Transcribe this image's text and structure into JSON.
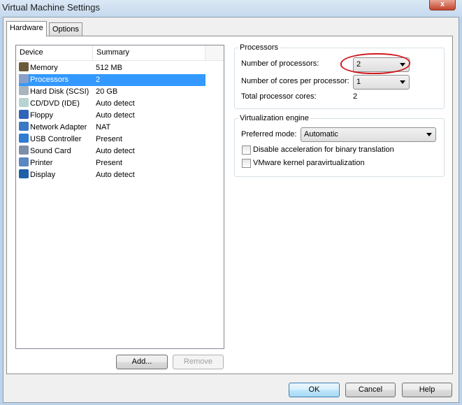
{
  "window": {
    "title": "Virtual Machine Settings",
    "close_label": "x"
  },
  "tabs": [
    {
      "label": "Hardware"
    },
    {
      "label": "Options"
    }
  ],
  "device_list": {
    "headers": {
      "device": "Device",
      "summary": "Summary"
    },
    "rows": [
      {
        "device": "Memory",
        "summary": "512 MB",
        "icon": "memory-icon",
        "color": "#6b5a3a"
      },
      {
        "device": "Processors",
        "summary": "2",
        "icon": "processor-icon",
        "color": "#8aa0c8",
        "selected": true
      },
      {
        "device": "Hard Disk (SCSI)",
        "summary": "20 GB",
        "icon": "hard-disk-icon",
        "color": "#a9b4bc"
      },
      {
        "device": "CD/DVD (IDE)",
        "summary": "Auto detect",
        "icon": "cd-dvd-icon",
        "color": "#b8d4d0"
      },
      {
        "device": "Floppy",
        "summary": "Auto detect",
        "icon": "floppy-icon",
        "color": "#2f64b8"
      },
      {
        "device": "Network Adapter",
        "summary": "NAT",
        "icon": "network-adapter-icon",
        "color": "#3b79c4"
      },
      {
        "device": "USB Controller",
        "summary": "Present",
        "icon": "usb-icon",
        "color": "#2f7cd0"
      },
      {
        "device": "Sound Card",
        "summary": "Auto detect",
        "icon": "sound-card-icon",
        "color": "#7d8ea8"
      },
      {
        "device": "Printer",
        "summary": "Present",
        "icon": "printer-icon",
        "color": "#5a88c0"
      },
      {
        "device": "Display",
        "summary": "Auto detect",
        "icon": "display-icon",
        "color": "#1f5fa8"
      }
    ]
  },
  "buttons": {
    "add": "Add...",
    "remove": "Remove",
    "ok": "OK",
    "cancel": "Cancel",
    "help": "Help"
  },
  "processors": {
    "legend": "Processors",
    "num_processors_label": "Number of processors:",
    "num_processors_value": "2",
    "cores_label": "Number of cores per processor:",
    "cores_value": "1",
    "total_label": "Total processor cores:",
    "total_value": "2"
  },
  "virtualization": {
    "legend": "Virtualization engine",
    "mode_label": "Preferred mode:",
    "mode_value": "Automatic",
    "disable_accel_label": "Disable acceleration for binary translation",
    "disable_accel_checked": false,
    "paravirt_label": "VMware kernel paravirtualization",
    "paravirt_checked": false
  },
  "annotation_color": "#d0191e"
}
